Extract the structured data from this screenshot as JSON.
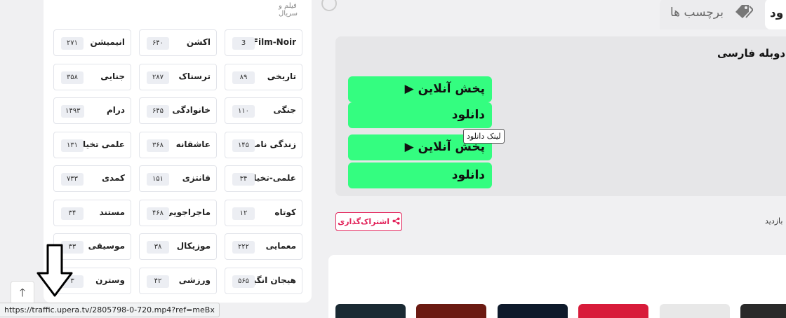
{
  "genres_panel": {
    "header_label": "فیلم و سریال",
    "genres": [
      {
        "name": "Film-Noir",
        "count": "3"
      },
      {
        "name": "اکشن",
        "count": "۶۴۰"
      },
      {
        "name": "انیمیشن",
        "count": "۲۷۱"
      },
      {
        "name": "تاریخی",
        "count": "۸۹"
      },
      {
        "name": "ترسناک",
        "count": "۲۸۷"
      },
      {
        "name": "جنایی",
        "count": "۳۵۸"
      },
      {
        "name": "جنگی",
        "count": "۱۱۰"
      },
      {
        "name": "خانوادگی",
        "count": "۶۴۵"
      },
      {
        "name": "درام",
        "count": "۱۴۹۳"
      },
      {
        "name": "زندگی نامه",
        "count": "۱۴۵"
      },
      {
        "name": "عاشقانه",
        "count": "۳۶۸"
      },
      {
        "name": "علمی تخیلی",
        "count": "۱۳۱"
      },
      {
        "name": "علمی-تخیلی",
        "count": "۳۴"
      },
      {
        "name": "فانتزی",
        "count": "۱۵۱"
      },
      {
        "name": "کمدی",
        "count": "۷۳۳"
      },
      {
        "name": "کوتاه",
        "count": "۱۲"
      },
      {
        "name": "ماجراجویی",
        "count": "۴۶۸"
      },
      {
        "name": "مستند",
        "count": "۳۴"
      },
      {
        "name": "معمایی",
        "count": "۲۲۲"
      },
      {
        "name": "موزیکال",
        "count": "۳۸"
      },
      {
        "name": "موسیقی",
        "count": "۳۳"
      },
      {
        "name": "هیجان انگیز",
        "count": "۵۶۵"
      },
      {
        "name": "ورزشی",
        "count": "۴۲"
      },
      {
        "name": "وسترن",
        "count": "۳"
      }
    ]
  },
  "tabs": {
    "tags_label": "برچسب ها",
    "partial_label": "ود"
  },
  "content": {
    "dub_title": "د دوبله فارسی",
    "buttons": [
      {
        "label": "▶ پخش آنلاین"
      },
      {
        "label": "دانلود"
      },
      {
        "label": "▶ پخش آنلاین"
      },
      {
        "label": "دانلود"
      }
    ],
    "tooltip": "لینک دانلود",
    "share_label": "اشتراک‌گذاری",
    "visits_label": "بازدید"
  },
  "thumbnails": [
    {
      "color": "#1a2a33"
    },
    {
      "color": "#6b1a12"
    },
    {
      "color": "#0e1a2b"
    },
    {
      "color": "#d81b3a"
    },
    {
      "color": "#e8e8e8"
    },
    {
      "color": "#2a2a2a"
    }
  ],
  "status_bar": {
    "url": "https://traffic.upera.tv/2805798-0-720.mp4?ref=meBx"
  },
  "scroll_top": {
    "icon": "arrow-up-icon",
    "glyph": "🡑"
  },
  "colors": {
    "green": "#34fd80",
    "accent": "#e2235a"
  }
}
